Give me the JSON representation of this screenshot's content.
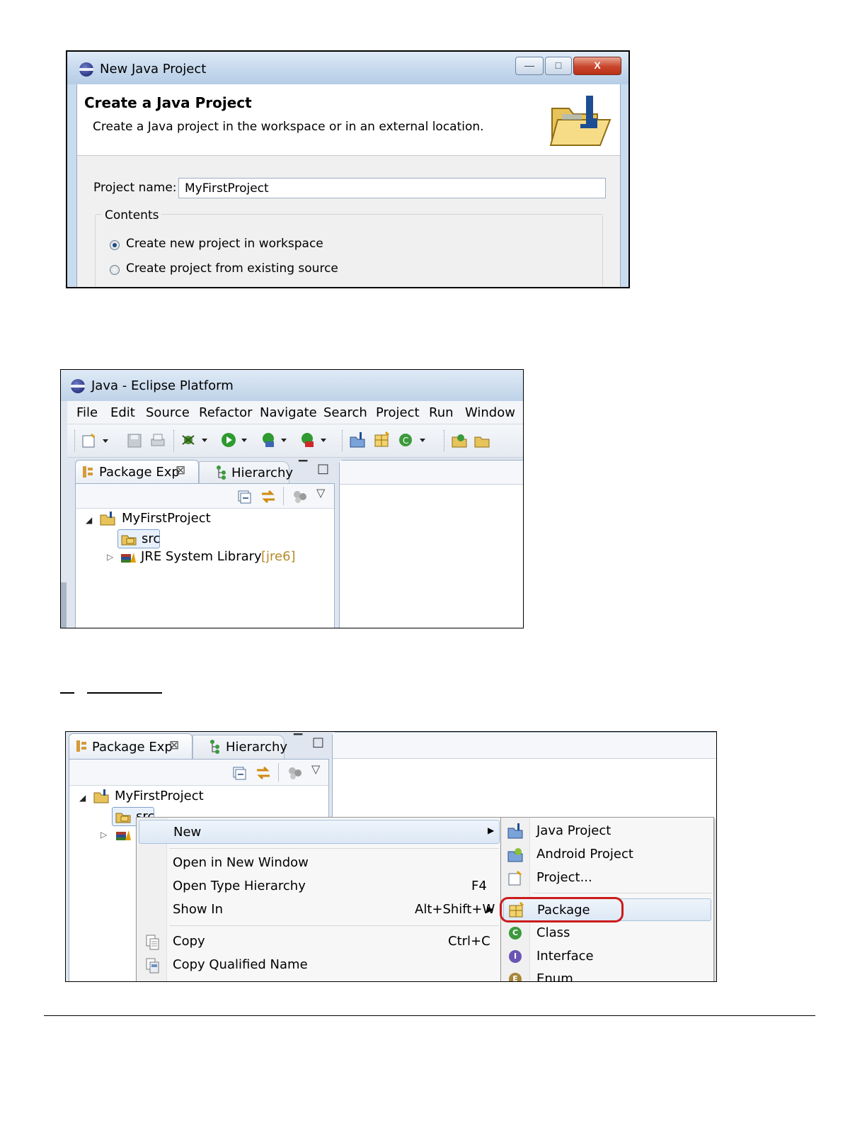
{
  "dialog": {
    "window_title": "New Java Project",
    "heading": "Create a Java Project",
    "description": "Create a Java project in the workspace or in an external location.",
    "window_buttons": {
      "minimize": "—",
      "maximize": "□",
      "close": "X"
    },
    "project_name_label": "Project name:",
    "project_name_value": "MyFirstProject",
    "contents_group_label": "Contents",
    "radio_new_label": "Create new project in workspace",
    "radio_existing_label": "Create project from existing source",
    "selected_radio": "new"
  },
  "eclipse": {
    "window_title": "Java - Eclipse Platform",
    "menu": [
      "File",
      "Edit",
      "Source",
      "Refactor",
      "Navigate",
      "Search",
      "Project",
      "Run",
      "Window"
    ],
    "tabs": {
      "package_explorer": "Package Exp",
      "hierarchy": "Hierarchy"
    },
    "tree": {
      "project": "MyFirstProject",
      "src": "src",
      "library": "JRE System Library",
      "library_suffix": "[jre6]"
    }
  },
  "context": {
    "tabs": {
      "package_explorer": "Package Exp",
      "hierarchy": "Hierarchy"
    },
    "tree": {
      "project": "MyFirstProject",
      "src": "src"
    },
    "menu": {
      "new": "New",
      "open_new_window": "Open in New Window",
      "open_type_hierarchy": "Open Type Hierarchy",
      "open_type_hierarchy_shortcut": "F4",
      "show_in": "Show In",
      "show_in_shortcut": "Alt+Shift+W",
      "copy": "Copy",
      "copy_shortcut": "Ctrl+C",
      "copy_qualified": "Copy Qualified Name"
    },
    "submenu": {
      "java_project": "Java Project",
      "android_project": "Android Project",
      "project": "Project...",
      "package": "Package",
      "class": "Class",
      "interface": "Interface",
      "enum": "Enum"
    },
    "highlighted_item": "Package",
    "highlight_color": "#cc1b1b"
  }
}
